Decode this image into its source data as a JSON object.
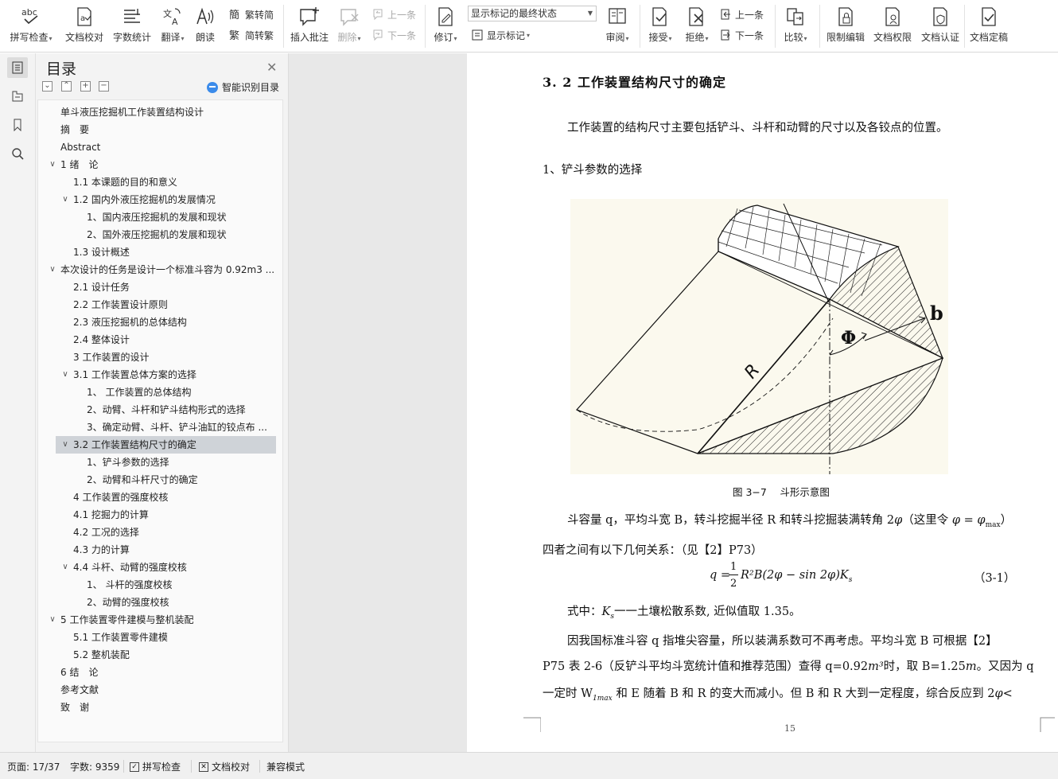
{
  "ribbon": {
    "spell": "拼写检查",
    "proof": "文档校对",
    "wordcount": "字数统计",
    "translate": "翻译",
    "read": "朗读",
    "trad_simp": "繁转简",
    "simp_trad": "简转繁",
    "insert_comment": "插入批注",
    "delete": "删除",
    "prev_comment": "上一条",
    "next_comment": "下一条",
    "revise": "修订",
    "markup_state": "显示标记的最终状态",
    "show_markup": "显示标记",
    "review": "审阅",
    "accept": "接受",
    "reject": "拒绝",
    "prev_change": "上一条",
    "next_change": "下一条",
    "compare": "比较",
    "restrict": "限制编辑",
    "permission": "文档权限",
    "certify": "文档认证",
    "finalize": "文档定稿",
    "abc": "abc"
  },
  "nav": {
    "title": "目录",
    "smart": "智能识别目录",
    "items": [
      {
        "text": "单斗液压挖掘机工作装置结构设计",
        "level": 0,
        "toggle": ""
      },
      {
        "text": "摘　要",
        "level": 0,
        "toggle": ""
      },
      {
        "text": "Abstract",
        "level": 0,
        "toggle": ""
      },
      {
        "text": "1 绪　论",
        "level": 0,
        "toggle": "v"
      },
      {
        "text": "1.1 本课题的目的和意义",
        "level": 1,
        "toggle": ""
      },
      {
        "text": "1.2 国内外液压挖掘机的发展情况",
        "level": 1,
        "toggle": "v"
      },
      {
        "text": "1、国内液压挖掘机的发展和现状",
        "level": 2,
        "toggle": ""
      },
      {
        "text": "2、国外液压挖掘机的发展和现状",
        "level": 2,
        "toggle": ""
      },
      {
        "text": "1.3 设计概述",
        "level": 1,
        "toggle": ""
      },
      {
        "text": "本次设计的任务是设计一个标准斗容为 0.92m3 ...",
        "level": 0,
        "toggle": "v"
      },
      {
        "text": "2.1 设计任务",
        "level": 1,
        "toggle": ""
      },
      {
        "text": "2.2 工作装置设计原则",
        "level": 1,
        "toggle": ""
      },
      {
        "text": "2.3 液压挖掘机的总体结构",
        "level": 1,
        "toggle": ""
      },
      {
        "text": "2.4 整体设计",
        "level": 1,
        "toggle": ""
      },
      {
        "text": "3 工作装置的设计",
        "level": 1,
        "toggle": ""
      },
      {
        "text": "3.1  工作装置总体方案的选择",
        "level": 1,
        "toggle": "v"
      },
      {
        "text": "1、  工作装置的总体结构",
        "level": 2,
        "toggle": ""
      },
      {
        "text": "2、动臂、斗杆和铲斗结构形式的选择",
        "level": 2,
        "toggle": ""
      },
      {
        "text": "3、确定动臂、斗杆、铲斗油缸的铰点布 ...",
        "level": 2,
        "toggle": ""
      },
      {
        "text": "3.2 工作装置结构尺寸的确定",
        "level": 1,
        "toggle": "v",
        "selected": true
      },
      {
        "text": "1、铲斗参数的选择",
        "level": 2,
        "toggle": ""
      },
      {
        "text": "2、动臂和斗杆尺寸的确定",
        "level": 2,
        "toggle": ""
      },
      {
        "text": "4 工作装置的强度校核",
        "level": 1,
        "toggle": ""
      },
      {
        "text": "4.1 挖掘力的计算",
        "level": 1,
        "toggle": ""
      },
      {
        "text": "4.2 工况的选择",
        "level": 1,
        "toggle": ""
      },
      {
        "text": "4.3 力的计算",
        "level": 1,
        "toggle": ""
      },
      {
        "text": "4.4 斗杆、动臂的强度校核",
        "level": 1,
        "toggle": "v"
      },
      {
        "text": "1、  斗杆的强度校核",
        "level": 2,
        "toggle": ""
      },
      {
        "text": "2、动臂的强度校核",
        "level": 2,
        "toggle": ""
      },
      {
        "text": "5 工作装置零件建模与整机装配",
        "level": 0,
        "toggle": "v"
      },
      {
        "text": "5.1 工作装置零件建模",
        "level": 1,
        "toggle": ""
      },
      {
        "text": "5.2 整机装配",
        "level": 1,
        "toggle": ""
      },
      {
        "text": "6 结　论",
        "level": 0,
        "toggle": ""
      },
      {
        "text": "参考文献",
        "level": 0,
        "toggle": ""
      },
      {
        "text": "致　谢",
        "level": 0,
        "toggle": ""
      }
    ]
  },
  "doc": {
    "heading": "3. 2 工作装置结构尺寸的确定",
    "p1": "工作装置的结构尺寸主要包括铲斗、斗杆和动臂的尺寸以及各铰点的位置。",
    "p2": "1、铲斗参数的选择",
    "fig_R": "R",
    "fig_phi": "Φ",
    "fig_b": "b",
    "fig_caption": "图 3−7　 斗形示意图",
    "p3a": "斗容量 q，平均斗宽 B，转斗挖掘半径 R 和转斗挖掘装满转角 2",
    "p3phi": "φ",
    "p3b": "（这里令 ",
    "p3eq": "φ = φ",
    "p3sub": "max",
    "p3c": "）",
    "p4": "四者之间有以下几何关系：（见【2】P73）",
    "eq_lhs": "q =",
    "eq_num": "1",
    "eq_den": "2",
    "eq_rhs": "R²B(2φ − sin 2φ)K",
    "eq_sub": "s",
    "eq_no": "（3-1）",
    "p5a": "式中：",
    "p5k": "K",
    "p5ks": "s",
    "p5b": "一一土壤松散系数, 近似值取 1.35。",
    "p6": "因我国标准斗容 q 指堆尖容量，所以装满系数可不再考虑。平均斗宽 B 可根据【2】",
    "p7a": "P75 表 2-6（反铲斗平均斗宽统计值和推荐范围）查得 q=0.92",
    "p7m": "m³",
    "p7b": "时，取 B=1.25",
    "p7c": "m",
    "p7d": "。又因为 q",
    "p8a": "一定时 W",
    "p8s": "1max",
    "p8b": " 和 E 随着 B 和 R 的变大而减小。但 B 和 R 大到一定程度，综合反应到 2",
    "p8phi": "φ",
    "p8c": "<",
    "page_no": "15"
  },
  "status": {
    "page": "页面: 17/37",
    "words": "字数: 9359",
    "spell": "拼写检查",
    "proof": "文档校对",
    "compat": "兼容模式"
  }
}
